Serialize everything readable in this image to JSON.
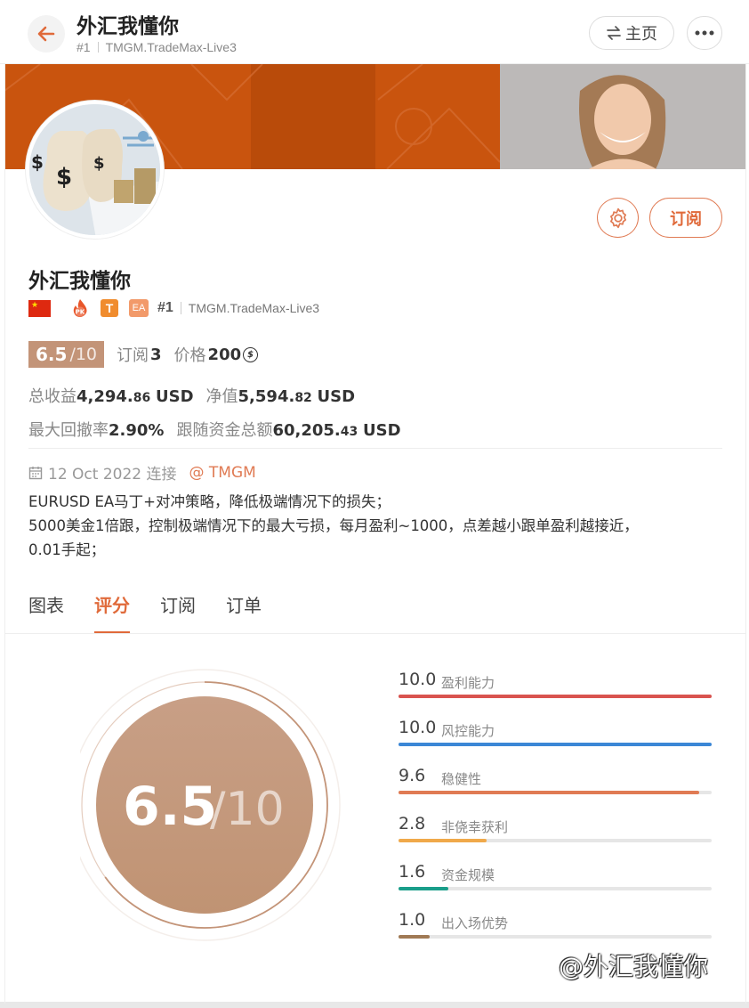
{
  "header": {
    "title": "外汇我懂你",
    "rank": "#1",
    "server": "TMGM.TradeMax-Live3",
    "home_label": "主页"
  },
  "profile": {
    "name": "外汇我懂你",
    "rank": "#1",
    "server": "TMGM.TradeMax-Live3",
    "badge_t": "T",
    "badge_ea": "EA",
    "badge_pk": "PK",
    "subscribe_label": "订阅"
  },
  "stats": {
    "score": "6.5",
    "score_max": "/10",
    "subs_label": "订阅",
    "subs_value": "3",
    "price_label": "价格",
    "price_value": "200",
    "price_symbol": "$",
    "total_profit_label": "总收益",
    "total_profit_int": "4,294.",
    "total_profit_dec": "86",
    "net_value_label": "净值",
    "net_value_int": "5,594.",
    "net_value_dec": "82",
    "currency": "USD",
    "max_drawdown_label": "最大回撤率",
    "max_drawdown_value": "2.90%",
    "follow_funds_label": "跟随资金总额",
    "follow_funds_int": "60,205.",
    "follow_funds_dec": "43"
  },
  "connection": {
    "date": "12 Oct 2022 连接",
    "broker": "@ TMGM"
  },
  "description": {
    "line1": "EURUSD EA马丁+对冲策略，降低极端情况下的损失；",
    "line2": "5000美金1倍跟，控制极端情况下的最大亏损，每月盈利~1000，点差越小跟单盈利越接近，",
    "line3": "0.01手起；"
  },
  "tabs": [
    {
      "label": "图表",
      "active": false
    },
    {
      "label": "评分",
      "active": true
    },
    {
      "label": "订阅",
      "active": false
    },
    {
      "label": "订单",
      "active": false
    }
  ],
  "gauge": {
    "score": "6.5",
    "max": "/10",
    "fraction": 0.65
  },
  "metrics": [
    {
      "value": "10.0",
      "label": "盈利能力",
      "pct": 100,
      "color": "#d9534f"
    },
    {
      "value": "10.0",
      "label": "风控能力",
      "pct": 100,
      "color": "#3b87d6"
    },
    {
      "value": "9.6",
      "label": "稳健性",
      "pct": 96,
      "color": "#e07b54"
    },
    {
      "value": "2.8",
      "label": "非侥幸获利",
      "pct": 28,
      "color": "#f0a94a"
    },
    {
      "value": "1.6",
      "label": "资金规模",
      "pct": 16,
      "color": "#1a9e8a"
    },
    {
      "value": "1.0",
      "label": "出入场优势",
      "pct": 10,
      "color": "#a07a55"
    }
  ],
  "watermark": "@外汇我懂你",
  "colors": {
    "accent": "#e06a3a",
    "banner_orange": "#c9540e",
    "score_bronze": "#c39478"
  }
}
